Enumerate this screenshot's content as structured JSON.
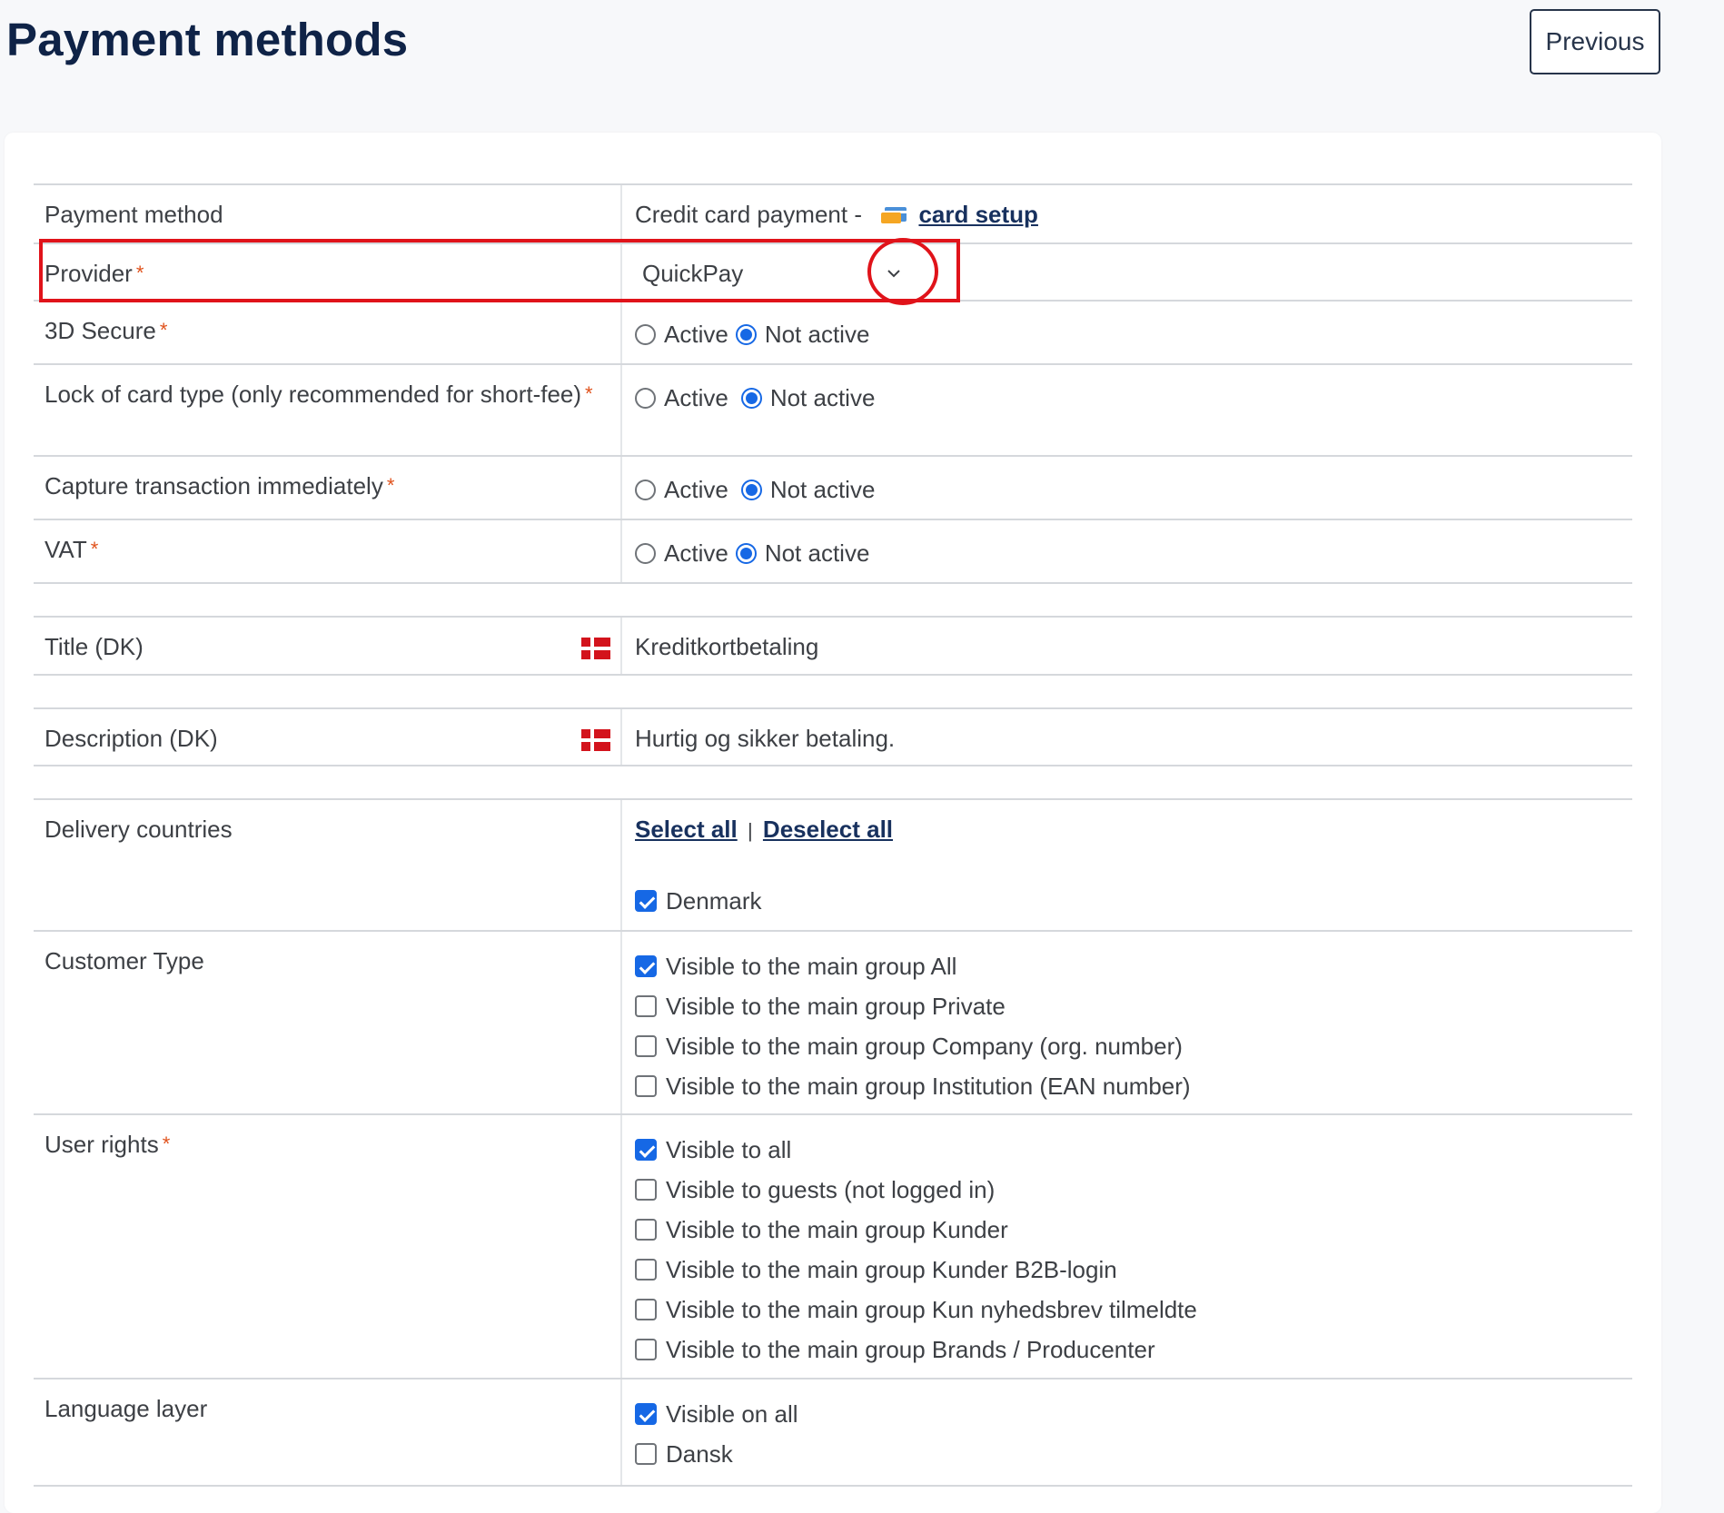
{
  "header": {
    "title": "Payment methods",
    "previous_label": "Previous"
  },
  "payment_method": {
    "label": "Payment method",
    "value": "Credit card payment -",
    "card_setup_link": "card setup"
  },
  "provider": {
    "label": "Provider",
    "required": "*",
    "selected": "QuickPay"
  },
  "toggles": [
    {
      "label": "3D Secure",
      "required": "*",
      "active_label": "Active",
      "not_active_label": "Not active",
      "value": "Not active"
    },
    {
      "label": "Lock of card type (only recommended for short-fee)",
      "required": "*",
      "active_label": "Active",
      "not_active_label": "Not active",
      "value": "Not active"
    },
    {
      "label": "Capture transaction immediately",
      "required": "*",
      "active_label": "Active",
      "not_active_label": "Not active",
      "value": "Not active"
    },
    {
      "label": "VAT",
      "required": "*",
      "active_label": "Active",
      "not_active_label": "Not active",
      "value": "Not active"
    }
  ],
  "title_dk": {
    "label": "Title (DK)",
    "value": "Kreditkortbetaling"
  },
  "description_dk": {
    "label": "Description (DK)",
    "value": "Hurtig og sikker betaling."
  },
  "delivery_countries": {
    "label": "Delivery countries",
    "select_all": "Select all",
    "separator": "|",
    "deselect_all": "Deselect all",
    "options": [
      {
        "label": "Denmark",
        "checked": true
      }
    ]
  },
  "customer_type": {
    "label": "Customer Type",
    "options": [
      {
        "label": "Visible to the main group All",
        "checked": true
      },
      {
        "label": "Visible to the main group Private",
        "checked": false
      },
      {
        "label": "Visible to the main group Company (org. number)",
        "checked": false
      },
      {
        "label": "Visible to the main group Institution (EAN number)",
        "checked": false
      }
    ]
  },
  "user_rights": {
    "label": "User rights",
    "required": "*",
    "options": [
      {
        "label": "Visible to all",
        "checked": true
      },
      {
        "label": "Visible to guests (not logged in)",
        "checked": false
      },
      {
        "label": "Visible to the main group Kunder",
        "checked": false
      },
      {
        "label": "Visible to the main group Kunder B2B-login",
        "checked": false
      },
      {
        "label": "Visible to the main group Kun nyhedsbrev tilmeldte",
        "checked": false
      },
      {
        "label": "Visible to the main group Brands / Producenter",
        "checked": false
      }
    ]
  },
  "language_layer": {
    "label": "Language layer",
    "options": [
      {
        "label": "Visible on all",
        "checked": true
      },
      {
        "label": "Dansk",
        "checked": false
      }
    ]
  },
  "colors": {
    "accent": "#1668e5",
    "title": "#0f2347",
    "highlight": "#e0131a",
    "required": "#e0521c",
    "flag": "#d3131c"
  }
}
